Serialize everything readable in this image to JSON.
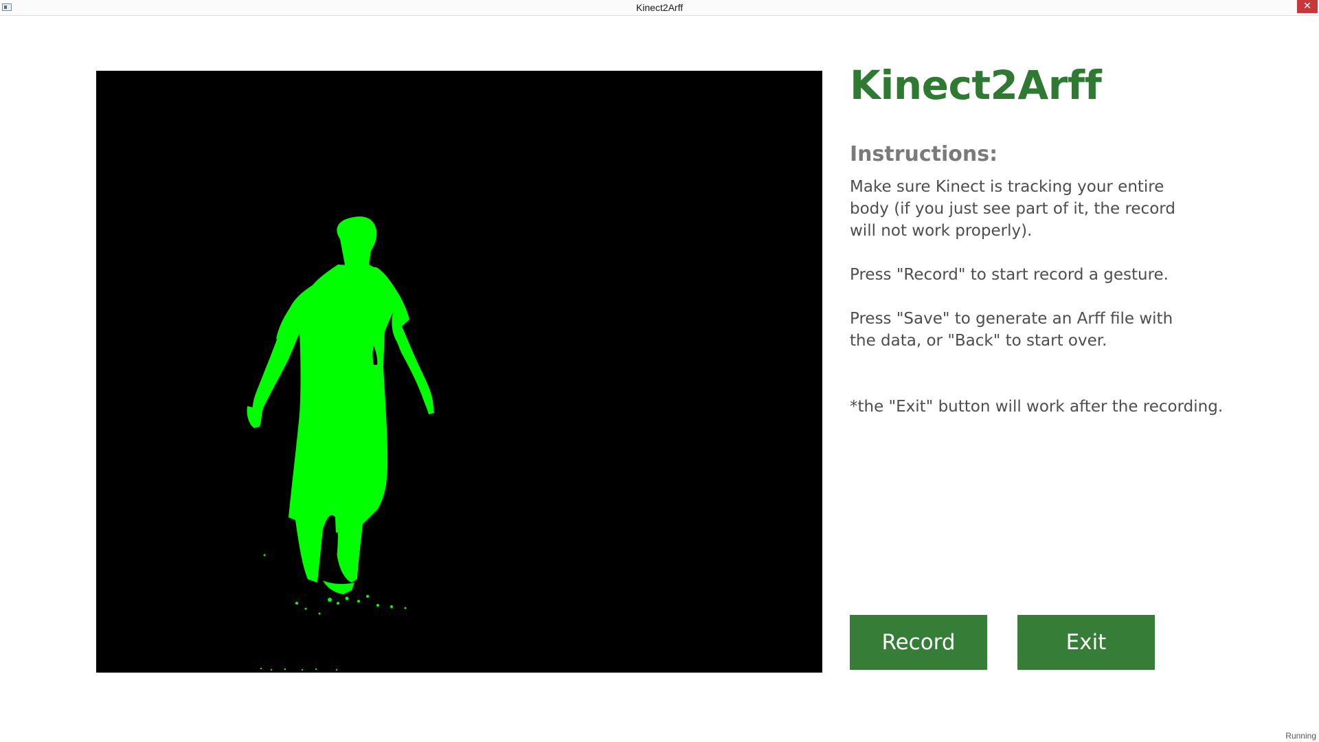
{
  "window": {
    "title": "Kinect2Arff",
    "close_glyph": "✕",
    "app_icon": "app-window-icon",
    "close_icon": "close-icon"
  },
  "video": {
    "background_color": "#000000",
    "silhouette_color": "#00ff00"
  },
  "main": {
    "heading": "Kinect2Arff",
    "instructions_title": "Instructions:",
    "instruction_1": "Make sure Kinect is tracking your entire body (if you just see part of it, the record will not work properly).",
    "instruction_2": "Press \"Record\" to start record a gesture.",
    "instruction_3": "Press \"Save\" to generate an Arff file with the data, or \"Back\" to start over.",
    "note": "*the \"Exit\" button will work after the recording."
  },
  "buttons": {
    "record_label": "Record",
    "exit_label": "Exit"
  },
  "status": {
    "text": "Running"
  },
  "colors": {
    "accent": "#2e7a32",
    "button": "#367e38",
    "heading_gray": "#7a7a7a",
    "close_red": "#c7383a"
  }
}
